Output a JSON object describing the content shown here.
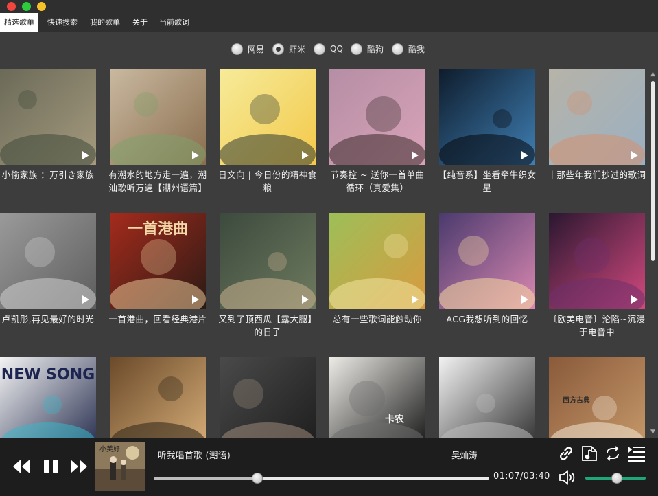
{
  "menu": {
    "items": [
      {
        "label": "精选歌单",
        "active": true
      },
      {
        "label": "快速搜索",
        "active": false
      },
      {
        "label": "我的歌单",
        "active": false
      },
      {
        "label": "关于",
        "active": false
      },
      {
        "label": "当前歌词",
        "active": false
      }
    ]
  },
  "sources": {
    "options": [
      {
        "label": "网易",
        "checked": false
      },
      {
        "label": "虾米",
        "checked": true
      },
      {
        "label": "QQ",
        "checked": false
      },
      {
        "label": "酷狗",
        "checked": false
      },
      {
        "label": "酷我",
        "checked": false
      }
    ]
  },
  "playlists": [
    {
      "title": "小偷家族 ：万引き家族",
      "palette": [
        "#6b6a58",
        "#a59a7e",
        "#3f4a3a"
      ]
    },
    {
      "title": "有潮水的地方走一遍，潮汕歌听万遍【潮州语篇】",
      "palette": [
        "#c9b9a0",
        "#8a6d4e",
        "#7fa06a"
      ]
    },
    {
      "title": "日文向 | 今日份的精神食粮",
      "palette": [
        "#f6eb9a",
        "#f3c94a",
        "#2f3a33"
      ]
    },
    {
      "title": "节奏控 ~ 送你一首单曲循环（真爱集）",
      "palette": [
        "#b58ea5",
        "#d9a3b8",
        "#3a2a2a"
      ]
    },
    {
      "title": "【纯音系】坐看牵牛织女星",
      "palette": [
        "#0e1c2c",
        "#3f7fb4",
        "#05070c"
      ]
    },
    {
      "title": "丨那些年我们抄过的歌词",
      "palette": [
        "#b7b3a8",
        "#9ab0c2",
        "#d58f6e"
      ]
    },
    {
      "title": "卢凯彤,再见最好的时光",
      "palette": [
        "#9a9a9a",
        "#5d5d5d",
        "#cfcfcf"
      ]
    },
    {
      "title": "一首港曲，回看经典港片",
      "palette": [
        "#a52b1c",
        "#2b1a15",
        "#e8c596"
      ]
    },
    {
      "title": "又到了顶西瓜【露大腿】的日子",
      "palette": [
        "#3c4a3e",
        "#6e7a5e",
        "#c9b08e"
      ]
    },
    {
      "title": "总有一些歌词能触动你",
      "palette": [
        "#9dbf58",
        "#d99a3f",
        "#f0e6a0"
      ]
    },
    {
      "title": "ACG我想听到的回忆",
      "palette": [
        "#4b3a6e",
        "#d988b0",
        "#f7d9a0"
      ]
    },
    {
      "title": "〔欧美电音〕沦陷~沉浸于电音中",
      "palette": [
        "#2a1730",
        "#d2497e",
        "#6f2f6c"
      ]
    },
    {
      "title": "",
      "palette": [
        "#f4f4f4",
        "#21284a",
        "#3ab7c8"
      ]
    },
    {
      "title": "",
      "palette": [
        "#6b4a2a",
        "#d9b07a",
        "#2d2517"
      ]
    },
    {
      "title": "",
      "palette": [
        "#4a4a4a",
        "#1c1c1c",
        "#9c8a7a"
      ]
    },
    {
      "title": "",
      "palette": [
        "#ecebe6",
        "#111111",
        "#6e6e6e"
      ]
    },
    {
      "title": "",
      "palette": [
        "#f2f2f2",
        "#2a2a2a",
        "#bcbcbc"
      ]
    },
    {
      "title": "",
      "palette": [
        "#8a5a3a",
        "#c79a6b",
        "#f2e6d4"
      ]
    }
  ],
  "cover_text": {
    "p8_title": "一首港曲",
    "p13_title": "NEW SONG",
    "p16_title": "卡农",
    "p18_title": "西方古典"
  },
  "player": {
    "track_title": "听我唱首歌 (潮语)",
    "artist": "吴灿涛",
    "time_readout": "01:07/03:40",
    "progress": 0.308,
    "volume": 0.52,
    "album_art_text": "小美好"
  },
  "icons": {
    "prev": "prev-icon",
    "pause": "pause-icon",
    "next": "next-icon",
    "link": "link-icon",
    "lyrics": "music-note-icon",
    "repeat": "repeat-icon",
    "playlist": "playlist-icon",
    "volume": "volume-icon"
  }
}
